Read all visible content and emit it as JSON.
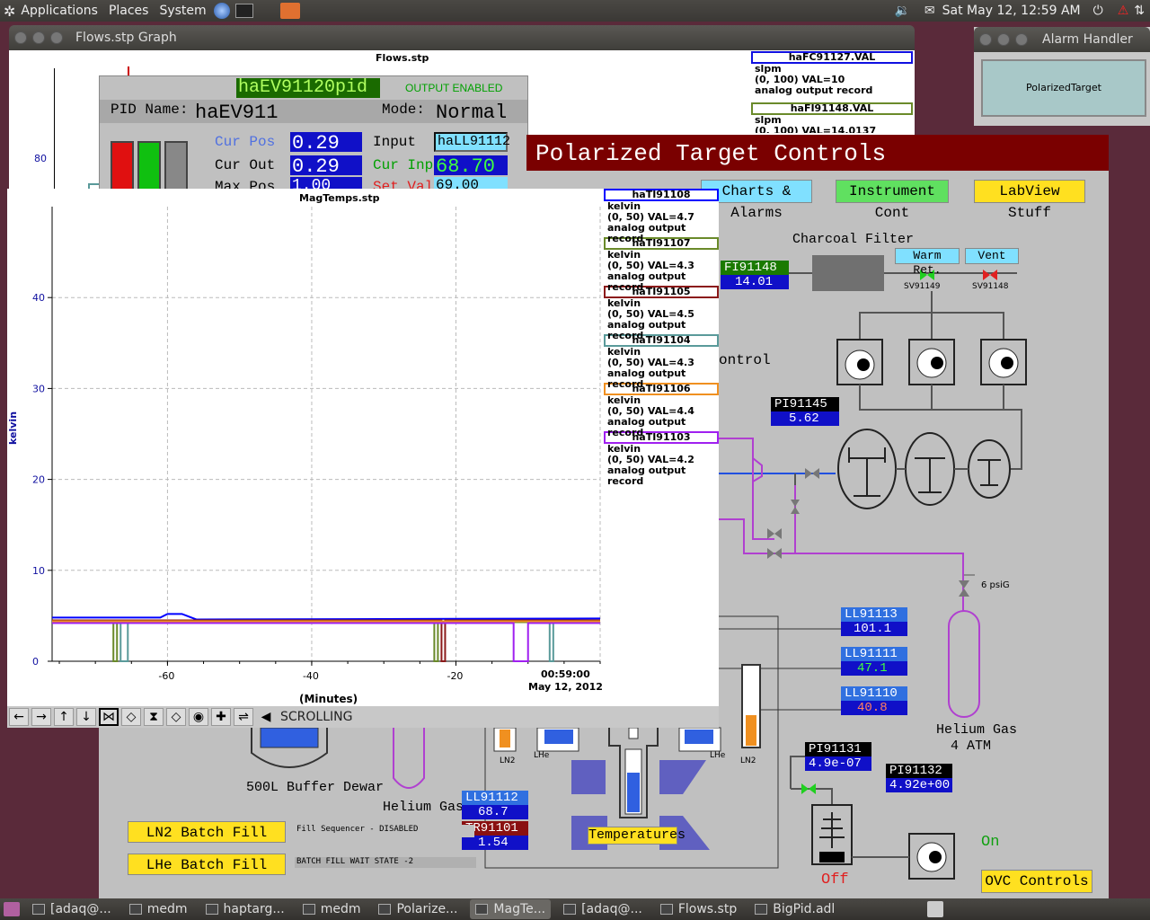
{
  "top_panel": {
    "apps": "Applications",
    "places": "Places",
    "system": "System",
    "datetime": "Sat May 12, 12:59 AM"
  },
  "flows_window": {
    "title": "Flows.stp Graph",
    "chart_title": "Flows.stp",
    "ytick_80": "80",
    "legend": [
      {
        "name": "haFC91127.VAL",
        "color": "#1010e0",
        "unit": "slpm",
        "range": "(0, 100) VAL=10",
        "desc": "analog output record"
      },
      {
        "name": "haFI91148.VAL",
        "color": "#6a8a2a",
        "unit": "slpm",
        "range": "(0, 100) VAL=14.0137",
        "desc": ""
      }
    ]
  },
  "alarm_window": {
    "title": "Alarm Handler",
    "button": "PolarizedTarget"
  },
  "pid": {
    "title": "haEV91120pid",
    "status": "OUTPUT ENABLED",
    "name_label": "PID Name:",
    "name": "haEV911",
    "mode_label": "Mode:",
    "mode": "Normal",
    "cur_pos_label": "Cur Pos",
    "cur_pos": "0.29",
    "input_label": "Input",
    "input": "haLL91112",
    "cur_out_label": "Cur Out",
    "cur_out": "0.29",
    "cur_inp_label": "Cur Inp",
    "cur_inp": "68.70",
    "max_pos_label": "Max Pos",
    "max_pos": "1.00",
    "set_val_label": "Set Val",
    "set_val": "69.00"
  },
  "ptc": {
    "title": "Polarized Target Controls",
    "charts_btn": "Charts & Alarms",
    "instr_btn": "Instrument Cont",
    "labview_btn": "LabView Stuff",
    "charcoal": "Charcoal Filter",
    "warm_ret": "Warm Ret.",
    "vent": "Vent",
    "sv91149": "SV91149",
    "sv91148": "SV91148",
    "fi91148_label": "FI91148",
    "fi91148_val": "14.01",
    "control_text": "ontrol",
    "pi91145_label": "PI91145",
    "pi91145_val": "5.62",
    "psig": "6 psiG",
    "ll91113_label": "LL91113",
    "ll91113_val": "101.1",
    "ll91111_label": "LL91111",
    "ll91111_val": "47.1",
    "ll91110_label": "LL91110",
    "ll91110_val": "40.8",
    "helium_gas_right": "Helium Gas",
    "atm": "4 ATM",
    "pi91131_label": "PI91131",
    "pi91131_val": "4.9e-07",
    "pi91132_label": "PI91132",
    "pi91132_val": "4.92e+00",
    "on": "On",
    "off": "Off",
    "ovc": "OVC Controls",
    "buffer_dewar": "500L Buffer Dewar",
    "helium_gas_left": "Helium Gas",
    "ll91112_label": "LL91112",
    "ll91112_val": "68.7",
    "tr91101_label": "TR91101",
    "tr91101_val": "1.54",
    "ln2_a": "LN2",
    "lhe_a": "LHe",
    "lhe_b": "LHe",
    "ln2_b": "LN2",
    "temperatures": "Temperatures",
    "ln2_fill": "LN2 Batch Fill",
    "lhe_fill": "LHe Batch Fill",
    "fill_seq": "Fill Sequencer - DISABLED",
    "batch_state": "BATCH FILL WAIT STATE -2"
  },
  "colors": {
    "blue": "#1010c8",
    "ptc_title_bg": "#7a0000",
    "green_btn": "#60e060",
    "yellow_btn": "#ffe020",
    "cyan_btn": "#80e0ff"
  },
  "chart_data": {
    "type": "line",
    "title": "MagTemps.stp",
    "ylabel": "kelvin",
    "xlabel": "(Minutes)",
    "ylim": [
      0,
      50
    ],
    "xlim": [
      -76,
      0
    ],
    "yticks": [
      "0",
      "10",
      "20",
      "30",
      "40"
    ],
    "xticks": [
      "-60",
      "-40",
      "-20"
    ],
    "x_end_label": "00:59:00",
    "x_date_label": "May 12, 2012",
    "legend_unit": "kelvin",
    "legend_desc": "analog output record",
    "series": [
      {
        "name": "haTI91108",
        "color": "#0000ff",
        "range": "(0, 50) VAL=4.7",
        "points": [
          [
            -76,
            4.8
          ],
          [
            -61,
            4.8
          ],
          [
            -60,
            5.2
          ],
          [
            -58,
            5.2
          ],
          [
            -56,
            4.6
          ],
          [
            0,
            4.7
          ]
        ]
      },
      {
        "name": "haTI91107",
        "color": "#6a8a2a",
        "range": "(0, 50) VAL=4.3",
        "points": [
          [
            -76,
            4.3
          ],
          [
            -67.5,
            4.3
          ],
          [
            -67.5,
            0
          ],
          [
            -67,
            0
          ],
          [
            -67,
            4.3
          ],
          [
            -23,
            4.3
          ],
          [
            -23,
            0
          ],
          [
            -22.5,
            0
          ],
          [
            -22.5,
            4.3
          ],
          [
            0,
            4.3
          ]
        ]
      },
      {
        "name": "haTI91105",
        "color": "#8b1a1a",
        "range": "(0, 50) VAL=4.5",
        "points": [
          [
            -76,
            4.5
          ],
          [
            -22,
            4.5
          ],
          [
            -22,
            0
          ],
          [
            -21.5,
            0
          ],
          [
            -21.5,
            4.5
          ],
          [
            0,
            4.5
          ]
        ]
      },
      {
        "name": "haTI91104",
        "color": "#5a9a9a",
        "range": "(0, 50) VAL=4.3",
        "points": [
          [
            -76,
            4.4
          ],
          [
            -66.5,
            4.4
          ],
          [
            -66.5,
            0
          ],
          [
            -65.5,
            0
          ],
          [
            -65.5,
            4.4
          ],
          [
            -7,
            4.4
          ],
          [
            -7,
            0
          ],
          [
            -6.5,
            0
          ],
          [
            -6.5,
            4.4
          ],
          [
            0,
            4.4
          ]
        ]
      },
      {
        "name": "haTI91106",
        "color": "#f09020",
        "range": "(0, 50) VAL=4.4",
        "points": [
          [
            -76,
            4.4
          ],
          [
            0,
            4.4
          ]
        ]
      },
      {
        "name": "haTI91103",
        "color": "#a020f0",
        "range": "(0, 50) VAL=4.2",
        "points": [
          [
            -76,
            4.2
          ],
          [
            -12,
            4.2
          ],
          [
            -12,
            0
          ],
          [
            -10,
            0
          ],
          [
            -10,
            4.2
          ],
          [
            0,
            4.2
          ]
        ]
      }
    ]
  },
  "magtemps_toolbar": {
    "scrolling": "SCROLLING"
  },
  "taskbar": [
    {
      "label": "[adaq@...",
      "active": false
    },
    {
      "label": "medm",
      "active": false
    },
    {
      "label": "haptarg...",
      "active": false
    },
    {
      "label": "medm",
      "active": false
    },
    {
      "label": "Polarize...",
      "active": false
    },
    {
      "label": "MagTe...",
      "active": true
    },
    {
      "label": "[adaq@...",
      "active": false
    },
    {
      "label": "Flows.stp",
      "active": false
    },
    {
      "label": "BigPid.adl",
      "active": false
    }
  ]
}
